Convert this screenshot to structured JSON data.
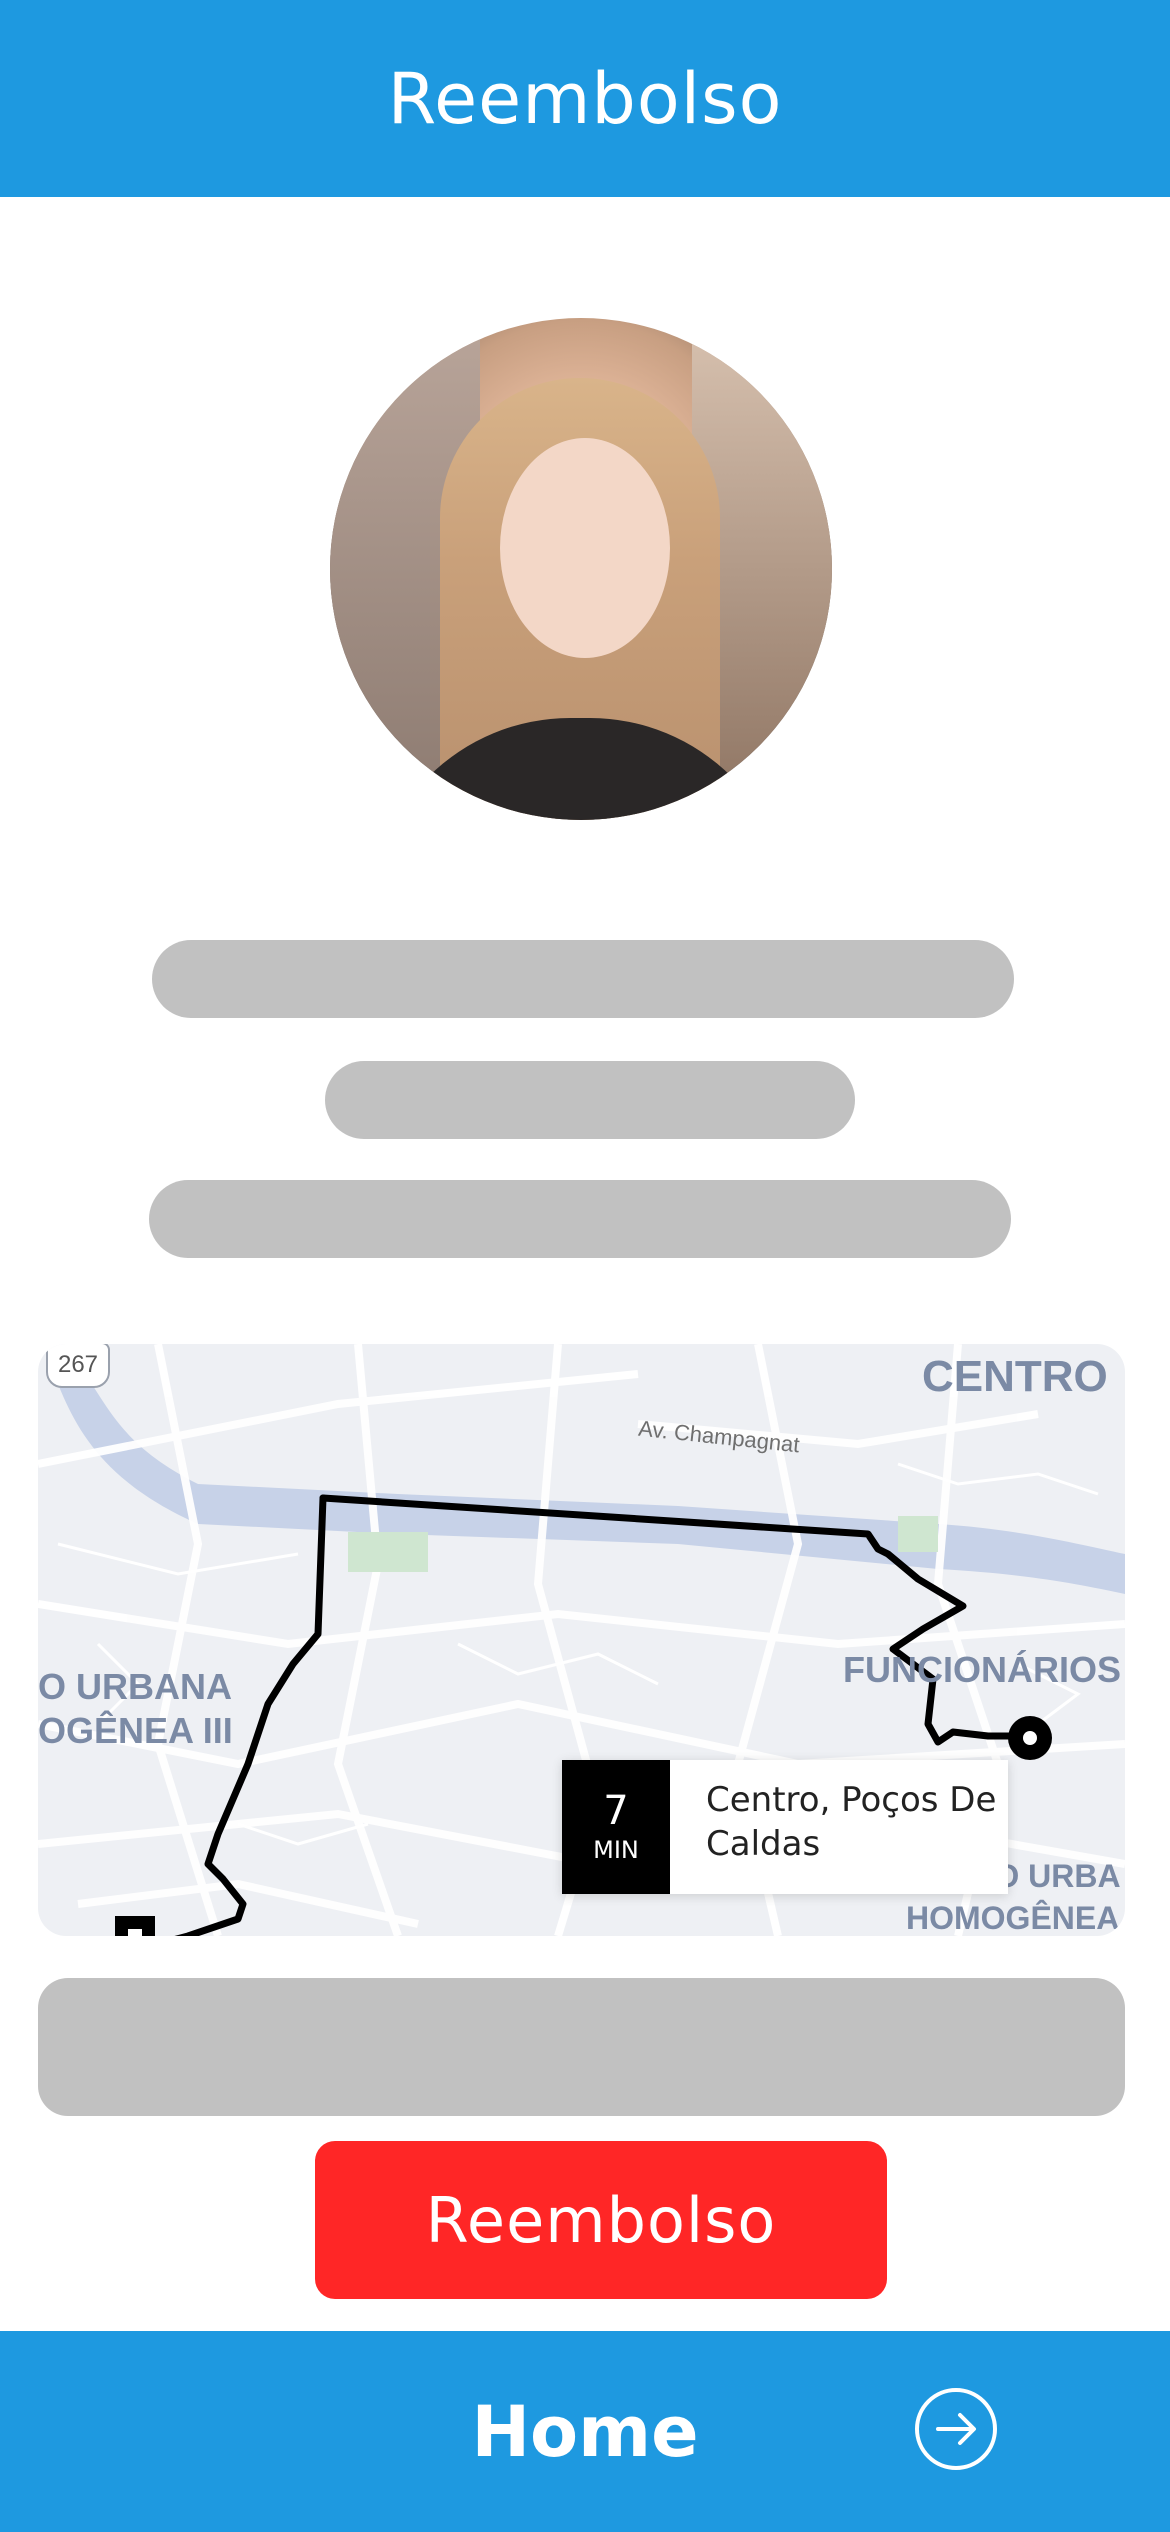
{
  "header": {
    "title": "Reembolso"
  },
  "map": {
    "labels": {
      "centro": "CENTRO",
      "funcionarios": "FUNCIONÁRIOS",
      "left_area_line1": "O URBANA",
      "left_area_line2": "OGÊNEA III",
      "right_area_line1": "REGIÃO URBA",
      "right_area_line2": "HOMOGÊNEA",
      "road": "Av. Champagnat",
      "shield": "267"
    },
    "eta": {
      "value": "7",
      "unit": "MIN",
      "destination": "Centro, Poços De Caldas"
    }
  },
  "actions": {
    "reembolso_label": "Reembolso"
  },
  "footer": {
    "home_label": "Home",
    "icon": "arrow-right-circle-icon"
  },
  "colors": {
    "primary": "#1e99e0",
    "danger": "#ff2626",
    "skeleton": "#c1c1c1"
  }
}
